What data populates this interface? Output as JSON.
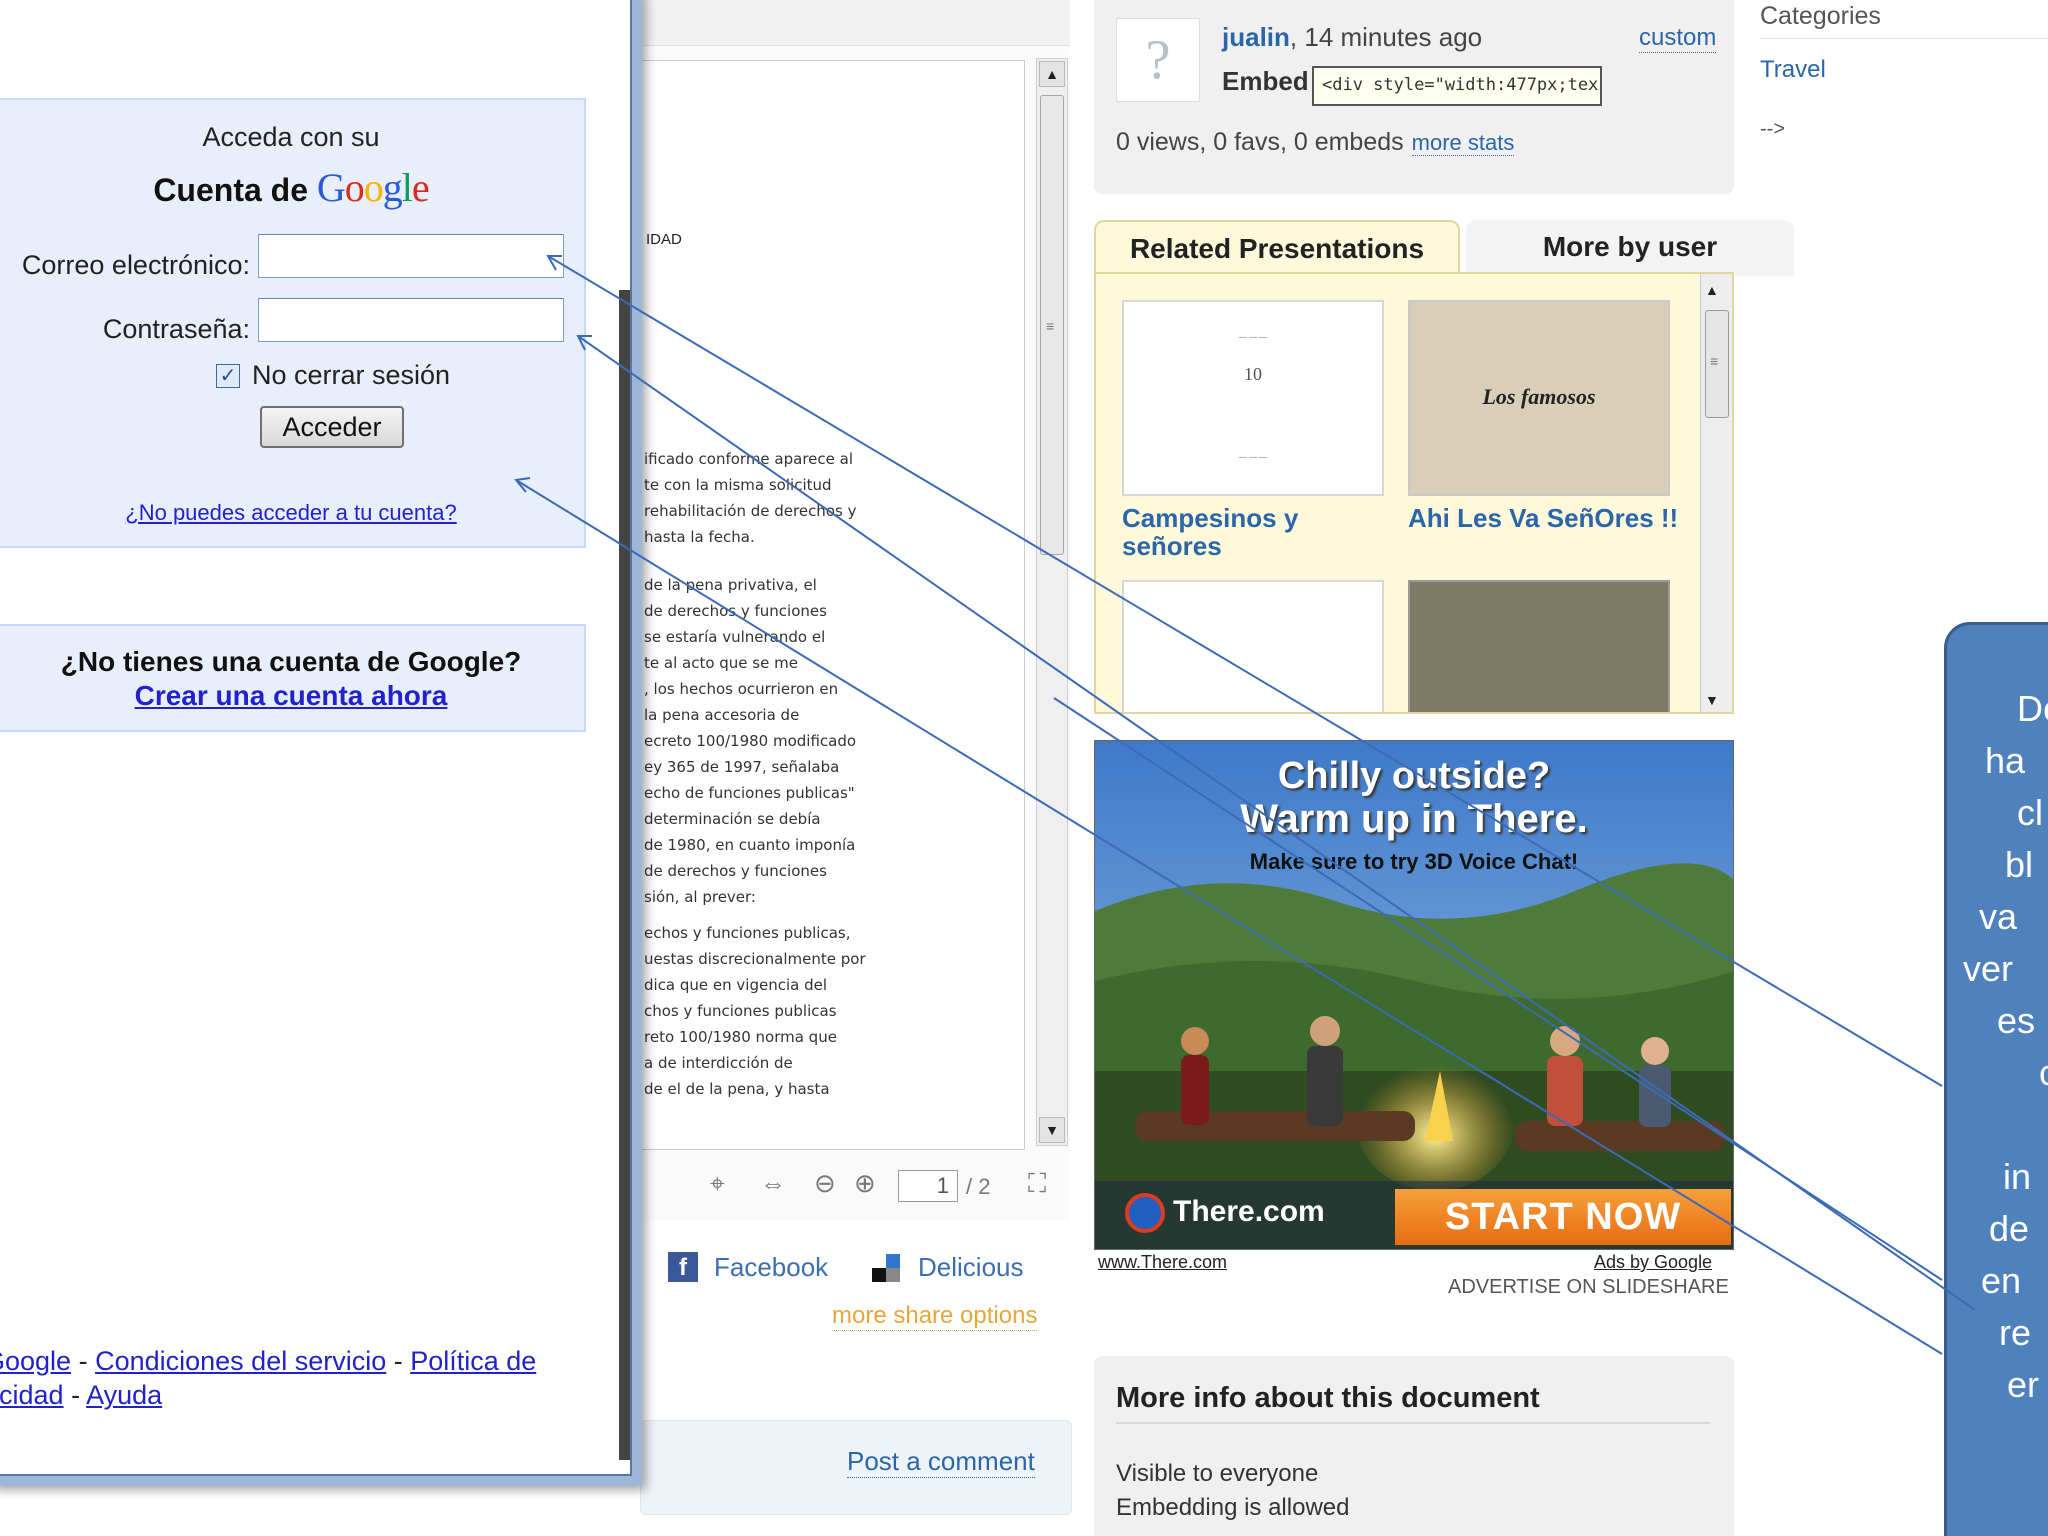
{
  "login": {
    "heading_line1": "Acceda con su",
    "heading_line2": "Cuenta de",
    "google_wordmark": "Google",
    "email_label": "Correo electrónico:",
    "email_value": "",
    "password_label": "Contraseña:",
    "password_value": "",
    "remember_label": "No cerrar sesión",
    "remember_checked": true,
    "submit_label": "Acceder",
    "forgot_link": "¿No puedes acceder a tu cuenta?"
  },
  "signup": {
    "question": "¿No tienes una cuenta de Google?",
    "link": "Crear una cuenta ahora"
  },
  "footer": {
    "link1": "Google",
    "sep1": " - ",
    "link2": "Condiciones del servicio",
    "sep2": " - ",
    "link3": "Política de",
    "link4": "acidad",
    "sep3": " - ",
    "link5": "Ayuda"
  },
  "document": {
    "heading_fragment": "IDAD",
    "lines_a": [
      "ificado conforme aparece al",
      "te con la misma solicitud",
      "rehabilitación de derechos y",
      "hasta la fecha."
    ],
    "lines_b": [
      "de la pena privativa, el",
      "de derechos y funciones",
      "se estaría vulnerando el",
      "te al acto que se me",
      ", los hechos ocurrieron en",
      "la pena accesoria de",
      "ecreto 100/1980 modificado",
      "ey 365 de 1997, señalaba",
      "echo de funciones publicas\"",
      "determinación se debía",
      "de 1980, en cuanto imponía",
      "de derechos y funciones",
      "sión, al prever:"
    ],
    "lines_c": [
      "echos y funciones publicas,",
      "uestas discrecionalmente por",
      "dica que en vigencia del",
      "chos y funciones publicas",
      "reto 100/1980 norma que",
      "a de interdicción de",
      "de el de la pena, y hasta"
    ],
    "current_page": "1",
    "total_pages": "/ 2"
  },
  "share": {
    "facebook": "Facebook",
    "delicious": "Delicious",
    "more": "more share options",
    "post_comment": "Post a comment"
  },
  "meta": {
    "author": "jualin",
    "time": ", 14 minutes ago",
    "custom": "custom",
    "embed_label": "Embed",
    "embed_code": "<div style=\"width:477px;tex",
    "stats": "0 views, 0 favs, 0 embeds",
    "more_stats": "more stats"
  },
  "related": {
    "tab_active": "Related Presentations",
    "tab_inactive": "More by user",
    "items": [
      {
        "title": "Campesinos y señores",
        "thumb_text": "10"
      },
      {
        "title": "Ahi Les Va SeñOres !!",
        "thumb_text": "Los famosos"
      }
    ]
  },
  "ad": {
    "line1": "Chilly outside?",
    "line2": "Warm up in There.",
    "line3": "Make sure to try 3D Voice Chat!",
    "logo": "There.com",
    "cta": "START NOW",
    "url": "www.There.com",
    "ads_by": "Ads by Google",
    "advertise": "ADVERTISE ON SLIDESHARE"
  },
  "info": {
    "title": "More info about this document",
    "line1": "Visible to everyone",
    "line2": "Embedding is allowed"
  },
  "categories": {
    "title": "Categories",
    "item": "Travel",
    "stray": "-->"
  },
  "callout": {
    "lines": [
      "De",
      "ha",
      "cl",
      "bl",
      "va",
      "ver",
      "es",
      "c",
      "",
      "in",
      "de",
      "en",
      "re",
      "er"
    ]
  },
  "colors": {
    "callout_fill": "#4f81bd",
    "link_blue": "#2a66a8",
    "google_link": "#2222cc"
  }
}
